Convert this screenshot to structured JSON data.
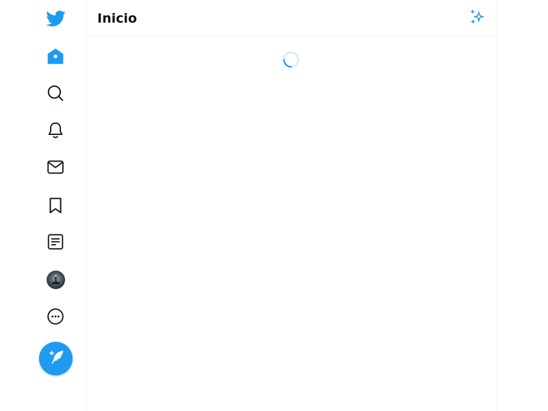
{
  "header": {
    "title": "Inicio"
  },
  "theme": {
    "accent": "#1d9bf0",
    "text": "#0f1419",
    "border": "#eff3f4",
    "spinner_track": "#cfe8fb"
  },
  "nav": {
    "items": [
      {
        "name": "logo",
        "icon": "twitter-bird-icon"
      },
      {
        "name": "home",
        "icon": "home-icon"
      },
      {
        "name": "explore",
        "icon": "search-icon"
      },
      {
        "name": "notifications",
        "icon": "bell-icon"
      },
      {
        "name": "messages",
        "icon": "envelope-icon"
      },
      {
        "name": "bookmarks",
        "icon": "bookmark-icon"
      },
      {
        "name": "lists",
        "icon": "list-icon"
      },
      {
        "name": "profile",
        "icon": "avatar"
      },
      {
        "name": "more",
        "icon": "more-circle-icon"
      }
    ],
    "compose_icon": "quill-plus-icon"
  },
  "main": {
    "loading": true,
    "toolbar_icon": "sparkle-icon"
  }
}
